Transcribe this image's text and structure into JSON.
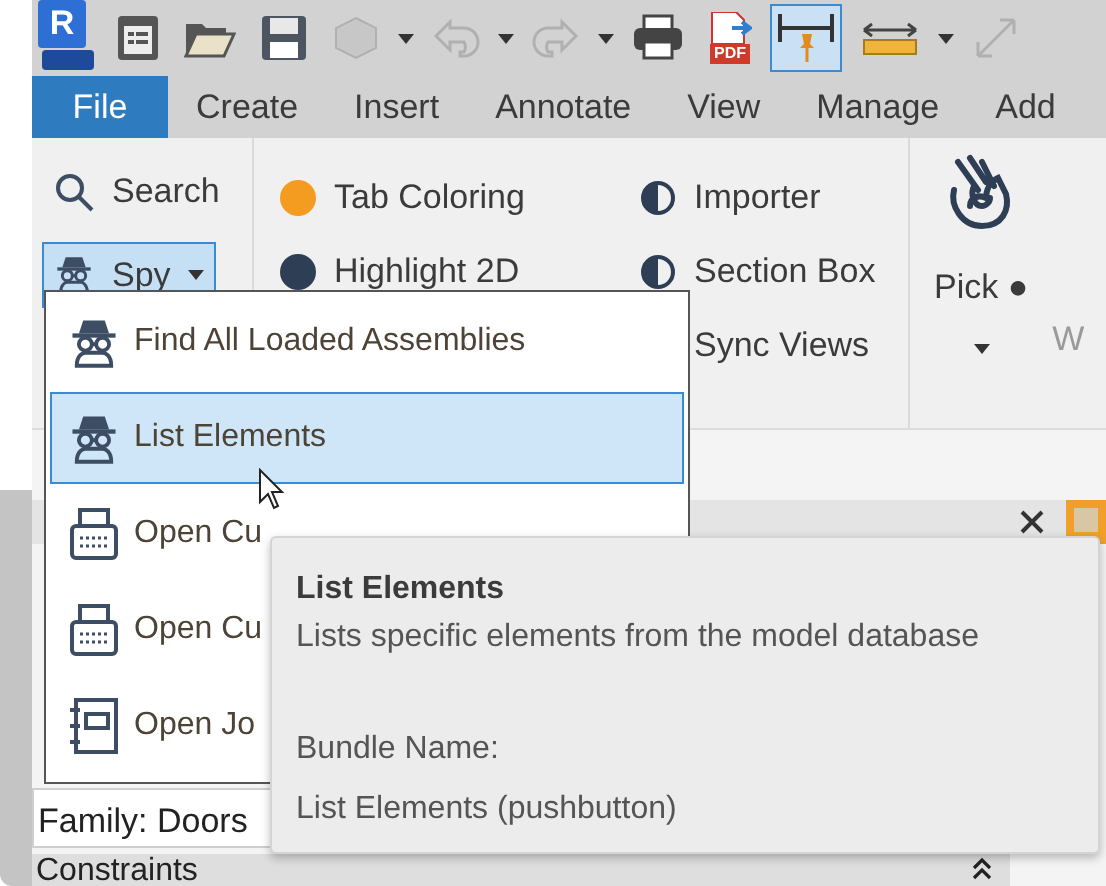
{
  "quick_access": [
    {
      "kind": "app-logo",
      "letter": "R"
    },
    {
      "kind": "properties"
    },
    {
      "kind": "open"
    },
    {
      "kind": "save"
    },
    {
      "kind": "model",
      "disabled": true,
      "dropdown": true
    },
    {
      "kind": "undo",
      "disabled": true,
      "dropdown": true
    },
    {
      "kind": "redo",
      "disabled": true,
      "dropdown": true
    },
    {
      "kind": "print"
    },
    {
      "kind": "pdf",
      "letter": "PDF"
    },
    {
      "kind": "measure",
      "selected": true
    },
    {
      "kind": "dimension",
      "dropdown": true
    },
    {
      "kind": "align",
      "disabled": true
    }
  ],
  "ribbon_tabs": [
    {
      "label": "File",
      "kind": "file",
      "selected": false
    },
    {
      "label": "Create",
      "kind": "tab",
      "selected": false
    },
    {
      "label": "Insert",
      "kind": "tab",
      "selected": false
    },
    {
      "label": "Annotate",
      "kind": "tab",
      "selected": false
    },
    {
      "label": "View",
      "kind": "tab",
      "selected": false
    },
    {
      "label": "Manage",
      "kind": "tab",
      "selected": false
    },
    {
      "label": "Add",
      "kind": "tab",
      "selected": false
    }
  ],
  "ribbon": {
    "panel_1": [
      {
        "label": "Search",
        "kind": "search",
        "pressed": false,
        "dropdown": false
      },
      {
        "label": "Spy",
        "kind": "spy",
        "pressed": true,
        "dropdown": true
      }
    ],
    "panel_2_left": [
      {
        "label": "Tab Coloring",
        "color": "#f39c1f"
      },
      {
        "label": "Highlight 2D",
        "color": "#2d3e55"
      }
    ],
    "panel_2_right": [
      {
        "label": "Importer",
        "icon": true
      },
      {
        "label": "Section Box",
        "icon": true
      },
      {
        "label": "Sync Views"
      }
    ],
    "pick": {
      "label": "Pick ●",
      "dropdown": true
    },
    "next_button": {
      "label": "W",
      "disabled": true
    }
  },
  "dropdown_menu": [
    {
      "label": "Find All Loaded Assemblies",
      "kind": "spy",
      "selected": false
    },
    {
      "label": "List Elements",
      "kind": "spy",
      "selected": true
    },
    {
      "label": "Open Cu",
      "kind": "typewriter",
      "selected": false
    },
    {
      "label": "Open Cu",
      "kind": "typewriter",
      "selected": false
    },
    {
      "label": "Open Jo",
      "kind": "notebook",
      "selected": false
    }
  ],
  "tooltip": {
    "title": "List Elements",
    "description": "Lists specific elements from the model database",
    "bundle_label": "Bundle Name:",
    "bundle_value": "List Elements (pushbutton)"
  },
  "properties": {
    "type_field": "Family: Doors",
    "section": {
      "label": "Constraints",
      "expanded": true
    }
  }
}
